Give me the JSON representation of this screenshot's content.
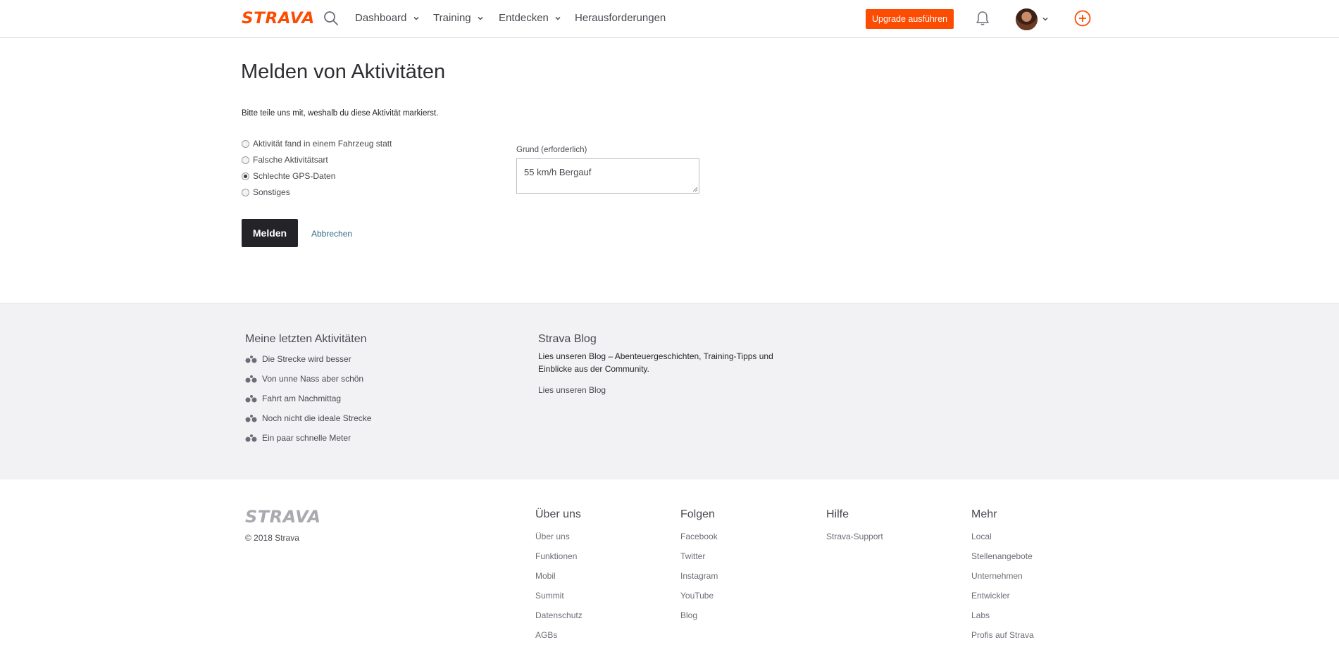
{
  "nav": {
    "logo": "STRAVA",
    "items": [
      {
        "label": "Dashboard",
        "has_menu": true
      },
      {
        "label": "Training",
        "has_menu": true
      },
      {
        "label": "Entdecken",
        "has_menu": true
      },
      {
        "label": "Herausforderungen",
        "has_menu": false
      }
    ],
    "upgrade_label": "Upgrade ausführen",
    "brand_color": "#fc4c02"
  },
  "form": {
    "title": "Melden von Aktivitäten",
    "intro": "Bitte teile uns mit, weshalb du diese Aktivität markierst.",
    "options": [
      {
        "label": "Aktivität fand in einem Fahrzeug statt",
        "checked": false
      },
      {
        "label": "Falsche Aktivitätsart",
        "checked": false
      },
      {
        "label": "Schlechte GPS-Daten",
        "checked": true
      },
      {
        "label": "Sonstiges",
        "checked": false
      }
    ],
    "reason_label": "Grund (erforderlich)",
    "reason_value": "55 km/h Bergauf",
    "submit_label": "Melden",
    "cancel_label": "Abbrechen"
  },
  "recent": {
    "heading": "Meine letzten Aktivitäten",
    "items": [
      "Die Strecke wird besser",
      "Von unne Nass aber schön",
      "Fahrt am Nachmittag",
      "Noch nicht die ideale Strecke",
      "Ein paar schnelle Meter"
    ]
  },
  "blog": {
    "heading": "Strava Blog",
    "text": "Lies unseren Blog – Abenteuergeschichten, Training-Tipps und Einblicke aus der Community.",
    "link": "Lies unseren Blog"
  },
  "footer": {
    "logo": "STRAVA",
    "copyright": "© 2018 Strava",
    "columns": [
      {
        "title": "Über uns",
        "links": [
          "Über uns",
          "Funktionen",
          "Mobil",
          "Summit",
          "Datenschutz",
          "AGBs"
        ]
      },
      {
        "title": "Folgen",
        "links": [
          "Facebook",
          "Twitter",
          "Instagram",
          "YouTube",
          "Blog"
        ]
      },
      {
        "title": "Hilfe",
        "links": [
          "Strava-Support"
        ]
      },
      {
        "title": "Mehr",
        "links": [
          "Local",
          "Stellenangebote",
          "Unternehmen",
          "Entwickler",
          "Labs",
          "Profis auf Strava"
        ]
      }
    ]
  }
}
